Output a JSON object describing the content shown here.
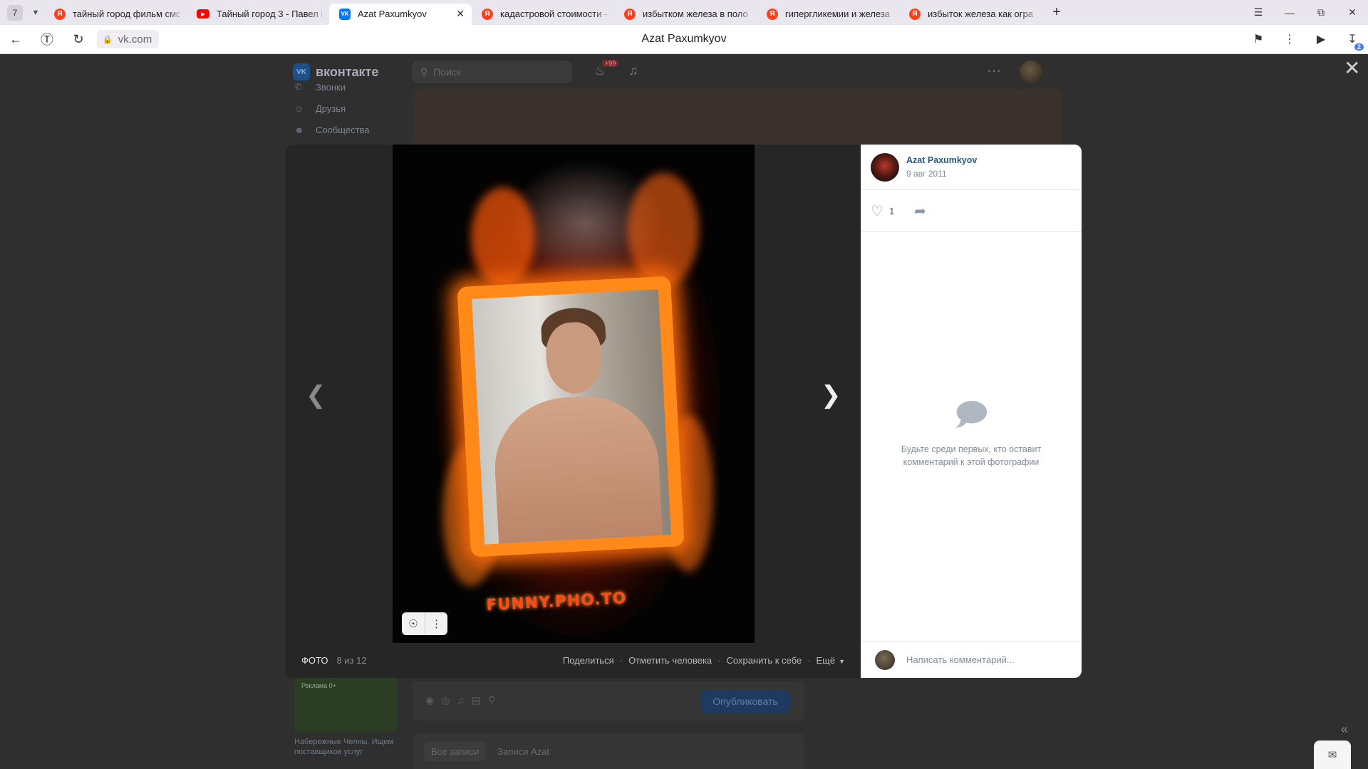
{
  "browser": {
    "tab_count": "7",
    "tabs": [
      {
        "title": "тайный город фильм смо",
        "icon": "yandex-icon"
      },
      {
        "title": "Тайный город 3 - Павел Г",
        "icon": "youtube-icon"
      },
      {
        "title": "Azat Paxumkyov",
        "icon": "vk-icon"
      },
      {
        "title": "кадастровой стоимости -",
        "icon": "yandex-icon"
      },
      {
        "title": "избытком железа в поло",
        "icon": "yandex-icon"
      },
      {
        "title": "гипергликемии и железа",
        "icon": "yandex-icon"
      },
      {
        "title": "избыток железа как огра",
        "icon": "yandex-icon"
      }
    ],
    "url": "vk.com",
    "page_title": "Azat Paxumkyov",
    "downloads_badge": "2"
  },
  "vk": {
    "logo_text": "вконтакте",
    "search_placeholder": "Поиск",
    "notifications_badge": "+99",
    "sidebar": [
      "Звонки",
      "Друзья",
      "Сообщества"
    ],
    "ad_label": "Реклама 0+",
    "ad_text": "Набережные Челны. Ищем поставщиков услуг",
    "publish_button": "Опубликовать",
    "wall_tabs": [
      "Все записи",
      "Записи Azat"
    ]
  },
  "viewer": {
    "section_label": "ФОТО",
    "counter": "8 из 12",
    "actions": [
      "Поделиться",
      "Отметить человека",
      "Сохранить к себе",
      "Ещё"
    ],
    "watermark": "FUNNY.PHO.TO",
    "author_name": "Azat Paxumkyov",
    "date": "9 авг 2011",
    "likes": "1",
    "empty_comments": "Будьте среди первых, кто оставит комментарий к этой фотографии",
    "comment_placeholder": "Написать комментарий..."
  }
}
